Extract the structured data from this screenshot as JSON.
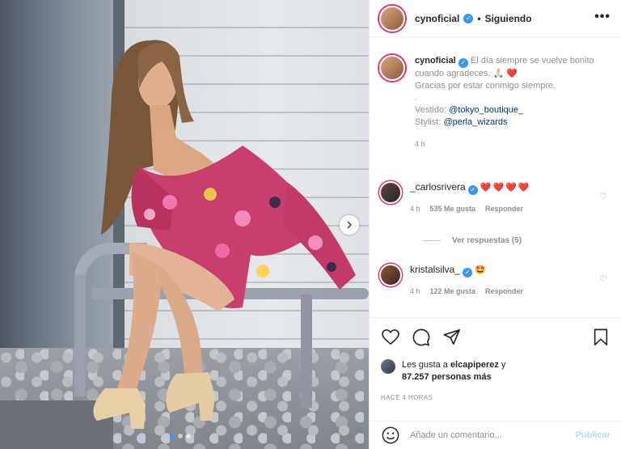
{
  "header": {
    "username": "cynoficial",
    "separator": "•",
    "follow_status": "Siguiendo",
    "more_icon": "more-options-icon"
  },
  "caption": {
    "username": "cynoficial",
    "line1": "El día siempre se vuelve bonito cuando agradeces. 🙏🏻 ❤️",
    "line2": "Gracias por estar conmigo siempre.",
    "line3": ".",
    "dress_label": "Vestido: ",
    "dress_mention": "@tokyo_boutique_",
    "stylist_label": "Stylist: ",
    "stylist_mention": "@perla_wizards",
    "time": "4 h"
  },
  "comments": [
    {
      "username": "_carlosrivera",
      "text": "❤️❤️❤️❤️",
      "time": "4 h",
      "likes": "535 Me gusta",
      "reply": "Responder",
      "view_replies": "Ver respuestas (5)"
    },
    {
      "username": "kristalsilva_",
      "text": "🤩",
      "time": "4 h",
      "likes": "122 Me gusta",
      "reply": "Responder"
    }
  ],
  "likes": {
    "prefix": "Les gusta a ",
    "user": "elcapiperez",
    "middle": " y",
    "count": "87.257 personas más"
  },
  "posted": "HACE 4 HORAS",
  "add_comment": {
    "placeholder": "Añade un comentario...",
    "publish": "Publicar"
  },
  "colors": {
    "verified": "#3897f0",
    "heart": "#ed4956",
    "link": "#00376b",
    "muted": "#8e8e8e",
    "publish_disabled": "#b2dffc"
  },
  "carousel": {
    "active_index": 1,
    "total": 3
  }
}
